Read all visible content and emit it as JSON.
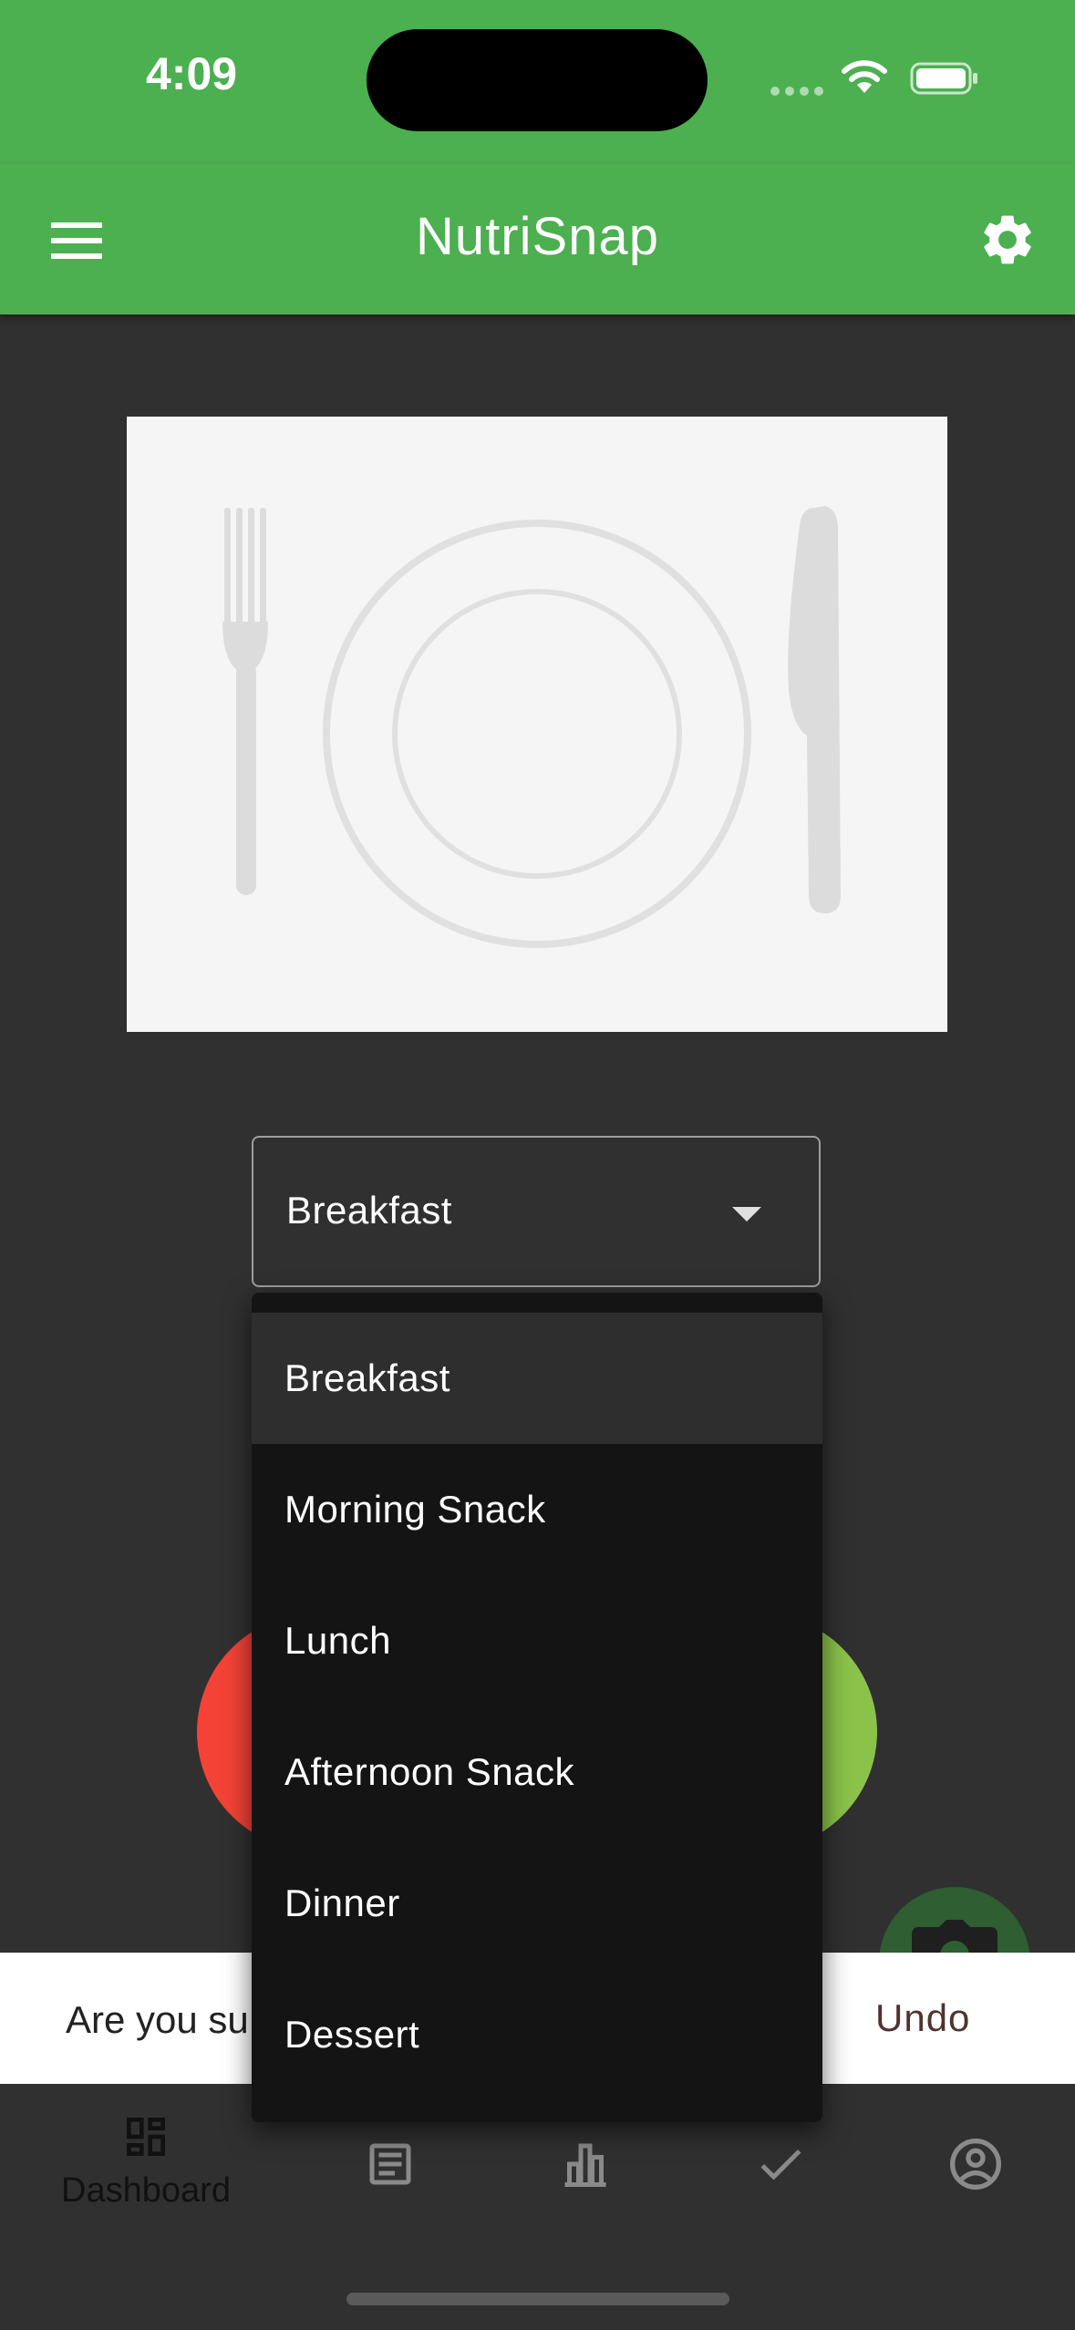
{
  "status_bar": {
    "time": "4:09"
  },
  "app_bar": {
    "title": "NutriSnap",
    "menu_icon": "hamburger-menu-icon",
    "settings_icon": "gear-icon"
  },
  "meal_image": {
    "icon": "plate-fork-knife-icon"
  },
  "meal_select": {
    "value": "Breakfast",
    "options": [
      "Breakfast",
      "Morning Snack",
      "Lunch",
      "Afternoon Snack",
      "Dinner",
      "Dessert"
    ],
    "selected_index": 0
  },
  "snackbar": {
    "text": "Are you su",
    "action_label": "Undo"
  },
  "bottom_nav": {
    "items": [
      {
        "label": "Dashboard",
        "icon": "dashboard-icon",
        "active": true
      },
      {
        "label": "",
        "icon": "article-icon",
        "active": false
      },
      {
        "label": "",
        "icon": "bar-chart-icon",
        "active": false
      },
      {
        "label": "",
        "icon": "check-icon",
        "active": false
      },
      {
        "label": "",
        "icon": "account-circle-icon",
        "active": false
      }
    ]
  },
  "colors": {
    "primary": "#4CAF50",
    "background": "#303030",
    "reject_circle": "#F44336",
    "accept_circle": "#8BC34A",
    "camera_fab": "#2E5E32",
    "undo_text": "#4E342E"
  }
}
